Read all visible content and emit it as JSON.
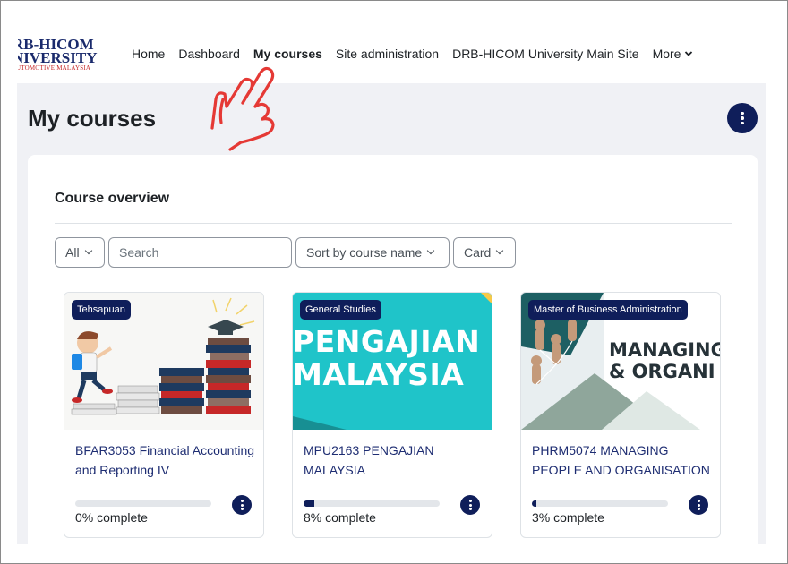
{
  "logo": {
    "line1": "RB-HICOM",
    "line2": "NIVERSITY",
    "line3": "UTOMOTIVE MALAYSIA"
  },
  "nav": {
    "items": [
      {
        "label": "Home",
        "active": false
      },
      {
        "label": "Dashboard",
        "active": false
      },
      {
        "label": "My courses",
        "active": true
      },
      {
        "label": "Site administration",
        "active": false
      },
      {
        "label": "DRB-HICOM University Main Site",
        "active": false
      }
    ],
    "more_label": "More"
  },
  "page": {
    "title": "My courses"
  },
  "overview": {
    "heading": "Course overview",
    "filter_value": "All",
    "search_placeholder": "Search",
    "sort_value": "Sort by course name",
    "view_value": "Card"
  },
  "courses": [
    {
      "category": "Tehsapuan",
      "name": "BFAR3053 Financial Accounting and Reporting IV",
      "progress_percent": 0,
      "progress_label": "0% complete"
    },
    {
      "category": "General Studies",
      "name": "MPU2163 PENGAJIAN MALAYSIA",
      "progress_percent": 8,
      "progress_label": "8% complete",
      "image_text": [
        "PENGAJIAN",
        "MALAYSIA"
      ]
    },
    {
      "category": "Master of Business Administration",
      "name": "PHRM5074 MANAGING PEOPLE AND ORGANISATION",
      "progress_percent": 3,
      "progress_label": "3% complete",
      "image_text": [
        "MANAGING",
        "& ORGANI"
      ]
    }
  ],
  "colors": {
    "brand": "#0f1e5a",
    "link": "#1e2d72",
    "page_bg": "#f0f1f5",
    "teal": "#1fc4c9",
    "annotation_red": "#e53935"
  },
  "icons": {
    "more": "chevron-down-icon",
    "actions": "kebab-menu-icon",
    "annotation": "pointing-hand-icon"
  }
}
